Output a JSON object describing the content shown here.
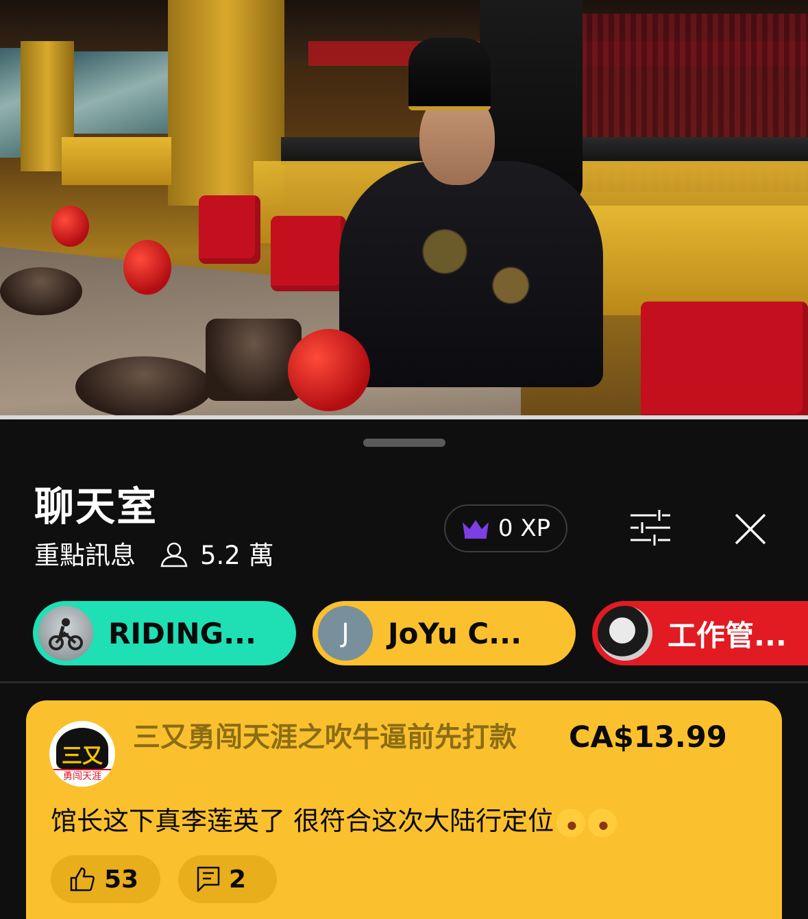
{
  "chat": {
    "title": "聊天室",
    "mode_label": "重點訊息",
    "viewer_count": "5.2 萬",
    "xp_label": "0 XP"
  },
  "pinned": [
    {
      "name": "RIDING...",
      "color": "#1ee0b4"
    },
    {
      "name": "JoYu C...",
      "avatar_letter": "J",
      "color": "#fbc02d"
    },
    {
      "name": "工作管...",
      "color": "#e21b23"
    }
  ],
  "super_chat": {
    "sender": "三又勇闯天涯之吹牛逼前先打款",
    "amount": "CA$13.99",
    "avatar_text": "三又",
    "avatar_banner": "勇闯天涯",
    "message": "馆长这下真李莲英了 很符合这次大陆行定位",
    "emoji": [
      "rolling-on-floor-laughing",
      "rolling-on-floor-laughing"
    ],
    "likes": "53",
    "replies": "2",
    "color": "#fbc02d"
  },
  "icons": {
    "viewers": "person-outline-icon",
    "xp": "crown-icon",
    "filter": "sliders-icon",
    "close": "close-icon",
    "like": "thumbs-up-icon",
    "reply": "comment-icon"
  }
}
